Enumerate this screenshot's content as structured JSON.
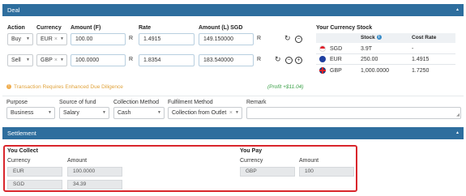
{
  "deal": {
    "title": "Deal",
    "headers": {
      "action": "Action",
      "currency": "Currency",
      "amount_f": "Amount (F)",
      "rate": "Rate",
      "amount_l": "Amount (L) SGD"
    },
    "rows": [
      {
        "action": "Buy",
        "currency": "EUR",
        "amount_f": "100.00",
        "rate": "1.4915",
        "amount_l": "149.150000",
        "r1": "R",
        "r2": "R",
        "r3": "R"
      },
      {
        "action": "Sell",
        "currency": "GBP",
        "amount_f": "100.0000",
        "rate": "1.8354",
        "amount_l": "183.540000",
        "r1": "R",
        "r2": "R",
        "r3": "R"
      }
    ],
    "stock": {
      "title": "Your Currency Stock",
      "col_stock": "Stock",
      "col_cost": "Cost Rate",
      "items": [
        {
          "code": "SGD",
          "stock": "3.9T",
          "cost": "-"
        },
        {
          "code": "EUR",
          "stock": "250.00",
          "cost": "1.4915"
        },
        {
          "code": "GBP",
          "stock": "1,000.0000",
          "cost": "1.7250"
        }
      ]
    },
    "warning": "Transaction Requires Enhanced Due Diligence",
    "profit": "(Profit +$11.04)"
  },
  "filters": {
    "purpose_label": "Purpose",
    "purpose_value": "Business",
    "source_label": "Source of fund",
    "source_value": "Salary",
    "collection_label": "Collection Method",
    "collection_value": "Cash",
    "fulfilment_label": "Fulfilment Method",
    "fulfilment_value": "Collection from Outlet",
    "remark_label": "Remark"
  },
  "settlement": {
    "title": "Settlement",
    "collect": {
      "title": "You Collect",
      "col_currency": "Currency",
      "col_amount": "Amount",
      "rows": [
        {
          "currency": "EUR",
          "amount": "100.0000"
        },
        {
          "currency": "SGD",
          "amount": "34.39"
        }
      ]
    },
    "pay": {
      "title": "You Pay",
      "col_currency": "Currency",
      "col_amount": "Amount",
      "rows": [
        {
          "currency": "GBP",
          "amount": "100"
        }
      ]
    }
  },
  "colors": {
    "header_bar": "#2e6e9e",
    "highlight_border": "#d9262c",
    "warning": "#e0a23a",
    "profit": "#3aa047"
  }
}
